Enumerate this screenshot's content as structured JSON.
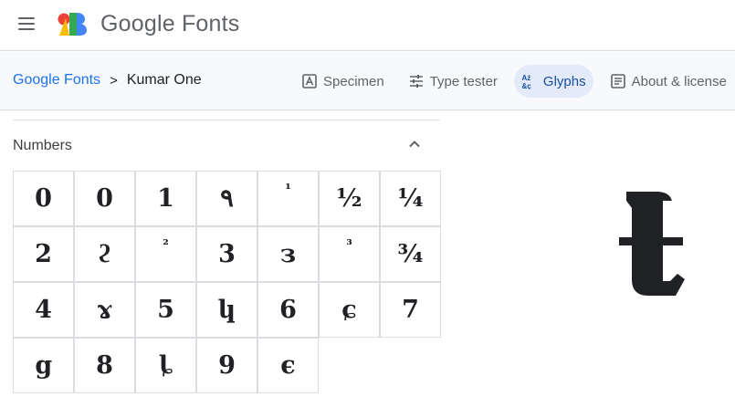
{
  "header": {
    "brand": "Google Fonts",
    "menu_icon": "hamburger-menu-icon",
    "logo_colors": [
      "#ea4335",
      "#fbbc04",
      "#34a853",
      "#4285f4"
    ]
  },
  "breadcrumb": {
    "root": "Google Fonts",
    "separator": ">",
    "current": "Kumar One"
  },
  "tabs": [
    {
      "label": "Specimen",
      "icon": "specimen-icon",
      "active": false
    },
    {
      "label": "Type tester",
      "icon": "sliders-icon",
      "active": false
    },
    {
      "label": "Glyphs",
      "icon": "glyphs-icon",
      "active": true
    },
    {
      "label": "About & license",
      "icon": "article-icon",
      "active": false
    }
  ],
  "numbers": {
    "title": "Numbers",
    "glyphs": [
      "0",
      "𝟎",
      "1",
      "٩",
      "¹",
      "½",
      "¼",
      "2",
      "ϩ",
      "²",
      "3",
      "з",
      "³",
      "¾",
      "4",
      "ɤ",
      "5",
      "կ",
      "6",
      "ɕ",
      "7",
      "ց",
      "8",
      "ȴ",
      "9",
      "є"
    ]
  },
  "preview": {
    "glyph_icon": "tenge-like-glyph-icon"
  },
  "colors": {
    "accent": "#1a73e8",
    "active_tab_bg": "#e3ebfb",
    "divider": "#dadce0"
  }
}
